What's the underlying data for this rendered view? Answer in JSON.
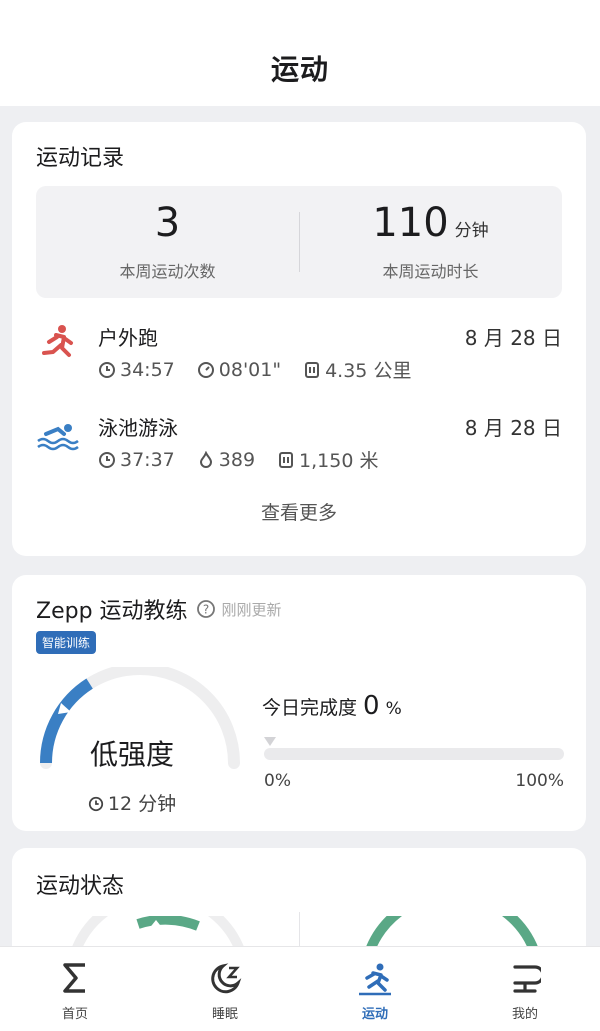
{
  "header": {
    "title": "运动"
  },
  "records": {
    "title": "运动记录",
    "summary": {
      "count_value": "3",
      "count_label": "本周运动次数",
      "duration_value": "110",
      "duration_unit": "分钟",
      "duration_label": "本周运动时长"
    },
    "items": [
      {
        "name": "户外跑",
        "date": "8 月 28 日",
        "icon": "running-icon",
        "stats": [
          "34:57",
          "08'01\"",
          "4.35 公里"
        ]
      },
      {
        "name": "泳池游泳",
        "date": "8 月 28 日",
        "icon": "swimming-icon",
        "stats": [
          "37:37",
          "389",
          "1,150 米"
        ]
      }
    ],
    "more_label": "查看更多"
  },
  "coach": {
    "title": "Zepp 运动教练",
    "updated": "刚刚更新",
    "tag": "智能训练",
    "intensity": "低强度",
    "time": "12 分钟",
    "progress_title": "今日完成度",
    "progress_value": "0",
    "progress_unit": "%",
    "progress_fraction": 0,
    "progress_min": "0%",
    "progress_max": "100%",
    "accent": "#3a7fc4"
  },
  "status": {
    "title": "运动状态",
    "accent": "#5aa886"
  },
  "tabs": [
    {
      "label": "首页",
      "icon": "sigma-icon"
    },
    {
      "label": "睡眠",
      "icon": "sleep-icon"
    },
    {
      "label": "运动",
      "icon": "workout-icon",
      "active": true
    },
    {
      "label": "我的",
      "icon": "profile-icon"
    }
  ]
}
